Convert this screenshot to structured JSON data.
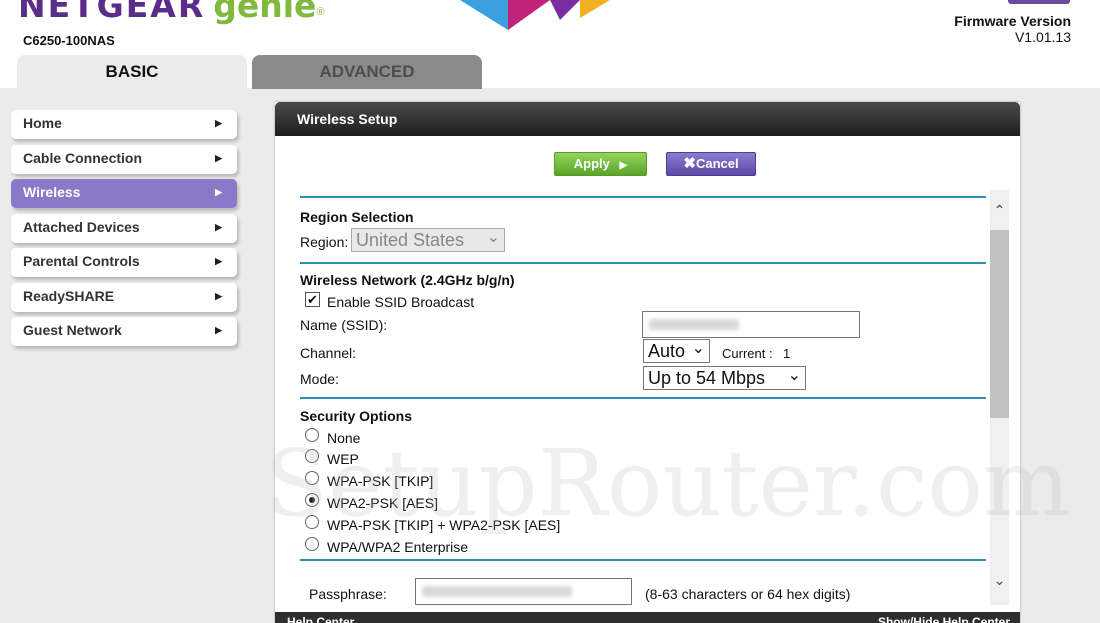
{
  "header": {
    "brand_name": "NETGEAR",
    "brand_product": "genie",
    "brand_mark": "®",
    "model": "C6250-100NAS",
    "firmware_label": "Firmware Version",
    "firmware_value": "V1.01.13"
  },
  "tabs": [
    {
      "label": "BASIC",
      "active": true
    },
    {
      "label": "ADVANCED",
      "active": false
    }
  ],
  "sidebar": {
    "items": [
      {
        "label": "Home",
        "active": false
      },
      {
        "label": "Cable Connection",
        "active": false
      },
      {
        "label": "Wireless",
        "active": true
      },
      {
        "label": "Attached Devices",
        "active": false
      },
      {
        "label": "Parental Controls",
        "active": false
      },
      {
        "label": "ReadySHARE",
        "active": false
      },
      {
        "label": "Guest Network",
        "active": false
      }
    ],
    "arrow_glyph": "▶"
  },
  "panel": {
    "title": "Wireless Setup",
    "apply_label": "Apply",
    "cancel_label": "Cancel",
    "region": {
      "heading": "Region Selection",
      "label": "Region:",
      "value": "United States"
    },
    "network": {
      "heading": "Wireless Network (2.4GHz b/g/n)",
      "ssid_broadcast_label": "Enable SSID Broadcast",
      "ssid_broadcast_checked": true,
      "name_label": "Name (SSID):",
      "channel_label": "Channel:",
      "channel_value": "Auto",
      "current_label": "Current :",
      "current_value": "1",
      "mode_label": "Mode:",
      "mode_value": "Up to 54 Mbps"
    },
    "security": {
      "heading": "Security Options",
      "options": [
        {
          "label": "None",
          "selected": false
        },
        {
          "label": "WEP",
          "selected": false
        },
        {
          "label": "WPA-PSK [TKIP]",
          "selected": false
        },
        {
          "label": "WPA2-PSK [AES]",
          "selected": true
        },
        {
          "label": "WPA-PSK [TKIP] + WPA2-PSK [AES]",
          "selected": false
        },
        {
          "label": "WPA/WPA2 Enterprise",
          "selected": false
        }
      ],
      "passphrase_label": "Passphrase:",
      "passphrase_hint": "(8-63 characters or 64 hex digits)"
    }
  },
  "footer": {
    "help_center": "Help Center",
    "show_hide": "Show/Hide Help Center"
  },
  "watermark": "SetupRouter.com",
  "colors": {
    "accent_purple": "#8a78c9",
    "apply_green": "#6cb83a",
    "rule_blue": "#2a8fb0",
    "brand_purple": "#5a2d8a",
    "brand_green": "#7fb93e"
  }
}
